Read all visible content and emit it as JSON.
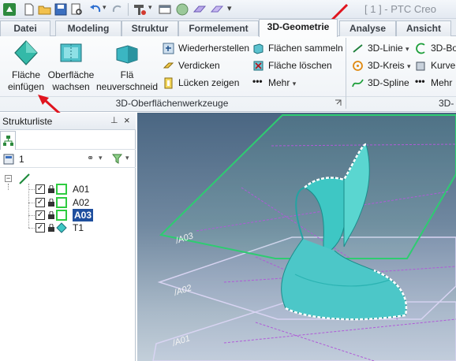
{
  "title_bar": {
    "app_title": "[ 1 ] - PTC Creo"
  },
  "tabs": [
    {
      "label": "Datei",
      "active": false
    },
    {
      "label": "Modeling",
      "active": false
    },
    {
      "label": "Struktur",
      "active": false
    },
    {
      "label": "Formelement",
      "active": false
    },
    {
      "label": "3D-Geometrie",
      "active": true
    },
    {
      "label": "Analyse",
      "active": false
    },
    {
      "label": "Ansicht",
      "active": false
    }
  ],
  "ribbon": {
    "group1": {
      "insert_surface_line1": "Fläche",
      "insert_surface_line2": "einfügen",
      "wrap_surface_line1": "Oberfläche",
      "wrap_surface_line2": "wachsen",
      "trim_line1": "Flä",
      "trim_line2": "neuverschneid",
      "restore": "Wiederherstellen",
      "thicken": "Verdicken",
      "show_gaps": "Lücken zeigen",
      "collect_faces": "Flächen sammeln",
      "delete_faces": "Fläche löschen",
      "more": "Mehr",
      "label": "3D-Oberflächenwerkzeuge"
    },
    "group2": {
      "line": "3D-Linie",
      "circle": "3D-Kreis",
      "spline": "3D-Spline",
      "arc": "3D-Bo",
      "curve": "Kurver",
      "more": "Mehr",
      "label": "3D-"
    }
  },
  "structure_panel": {
    "title": "Strukturliste",
    "count": "1",
    "items": [
      {
        "name": "A01",
        "checked": true,
        "selected": false
      },
      {
        "name": "A02",
        "checked": true,
        "selected": false
      },
      {
        "name": "A03",
        "checked": true,
        "selected": true
      },
      {
        "name": "T1",
        "checked": true,
        "selected": false
      }
    ]
  },
  "viewport": {
    "plane_labels": [
      "/A03",
      "/A02",
      "/A01"
    ]
  },
  "colors": {
    "accent": "#1f4f9e",
    "plane_active": "#2ecc71",
    "plane_inactive": "#d8d4f2",
    "surface": "#3ec7c4",
    "annotation": "#e0141e"
  }
}
